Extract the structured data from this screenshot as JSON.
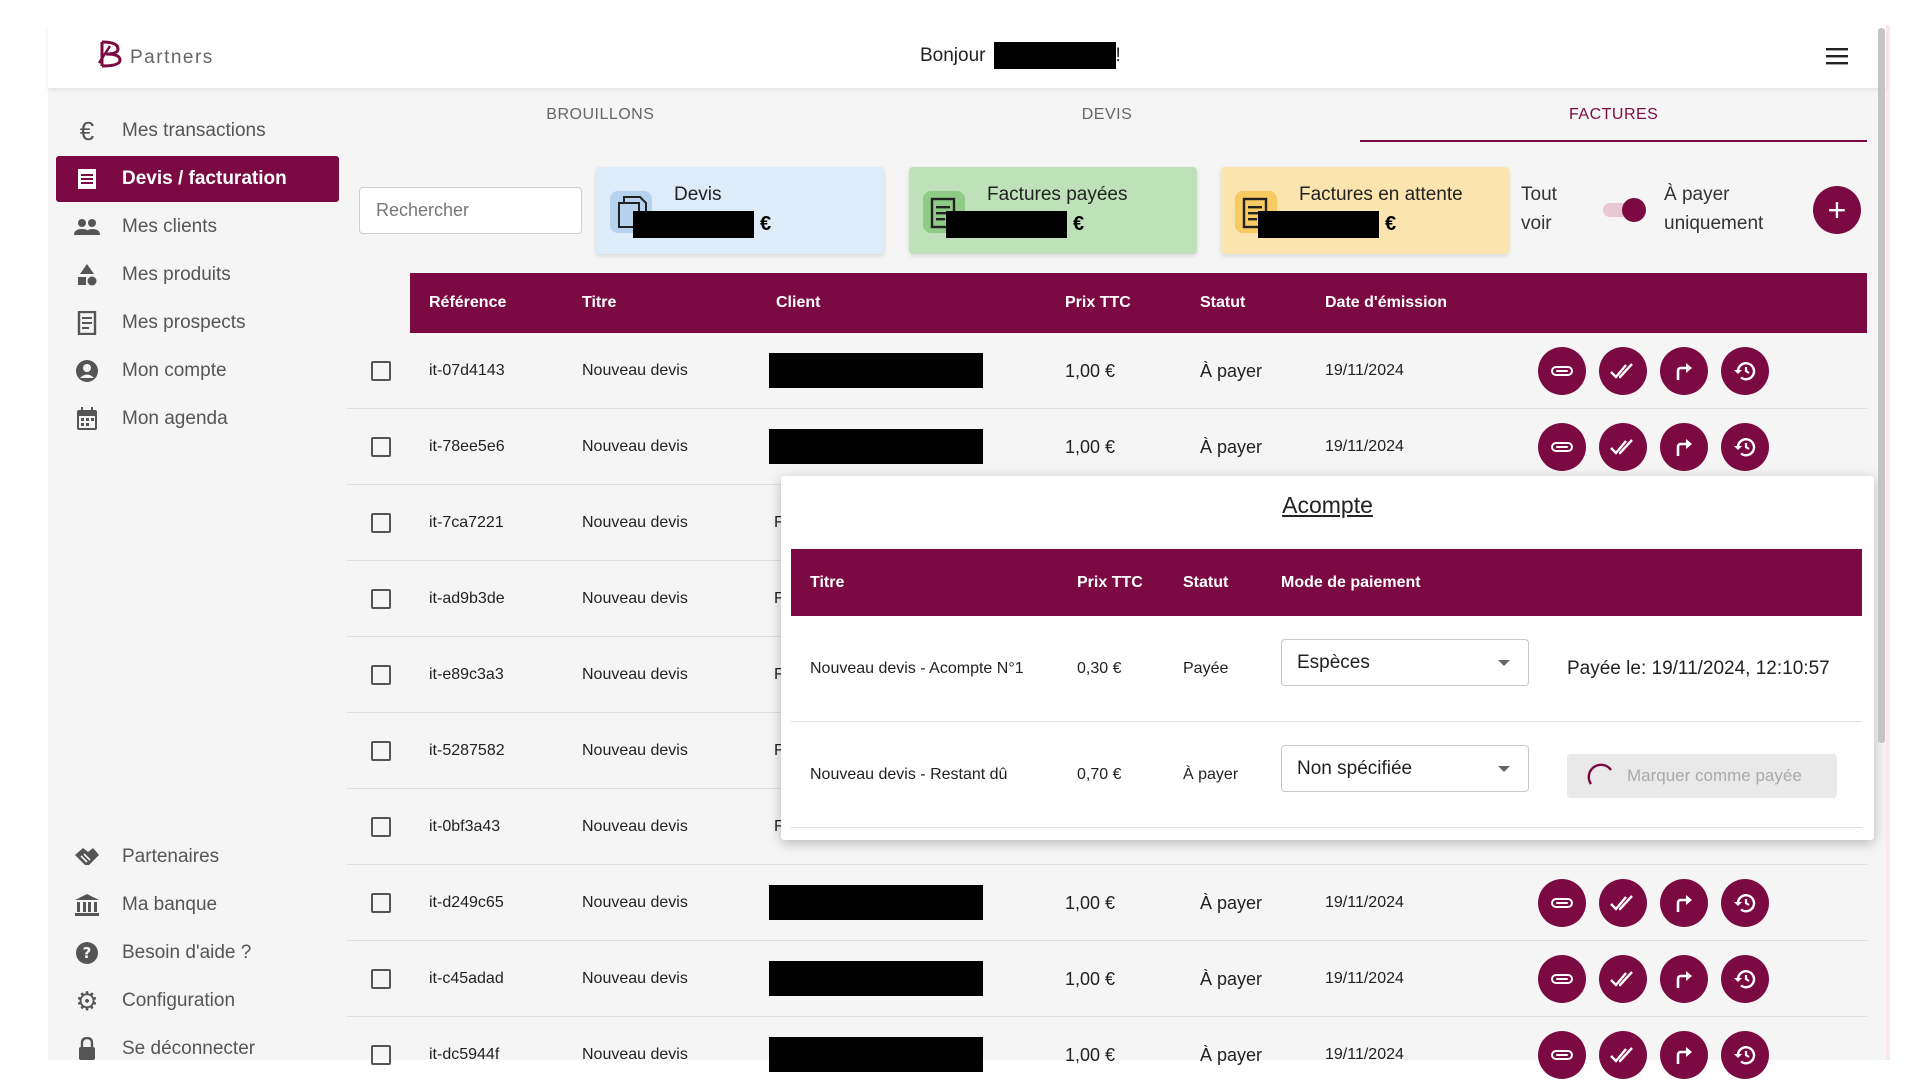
{
  "header": {
    "logo_text": "Partners",
    "greeting_prefix": "Bonjour",
    "greeting_suffix": "!"
  },
  "sidebar": {
    "top_items": [
      {
        "label": "Mes transactions",
        "icon": "euro-icon"
      },
      {
        "label": "Devis / facturation",
        "icon": "invoice-icon",
        "active": true
      },
      {
        "label": "Mes clients",
        "icon": "people-icon"
      },
      {
        "label": "Mes produits",
        "icon": "shapes-icon"
      },
      {
        "label": "Mes prospects",
        "icon": "receipt-icon"
      },
      {
        "label": "Mon compte",
        "icon": "account-circle-icon"
      },
      {
        "label": "Mon agenda",
        "icon": "calendar-icon"
      }
    ],
    "bottom_items": [
      {
        "label": "Partenaires",
        "icon": "handshake-icon"
      },
      {
        "label": "Ma banque",
        "icon": "bank-icon"
      },
      {
        "label": "Besoin d'aide ?",
        "icon": "help-icon"
      },
      {
        "label": "Configuration",
        "icon": "gear-icon"
      },
      {
        "label": "Se déconnecter",
        "icon": "lock-icon"
      }
    ]
  },
  "tabs": [
    {
      "label": "BROUILLONS"
    },
    {
      "label": "DEVIS"
    },
    {
      "label": "FACTURES",
      "active": true
    }
  ],
  "search": {
    "placeholder": "Rechercher"
  },
  "summary_cards": [
    {
      "title": "Devis",
      "currency": "€",
      "bg": "#deebf8",
      "icon_bg": "#b7d2ef"
    },
    {
      "title": "Factures payées",
      "currency": "€",
      "bg": "#bfe1b9",
      "icon_bg": "#8fcb86"
    },
    {
      "title": "Factures en attente",
      "currency": "€",
      "bg": "#fbe4ad",
      "icon_bg": "#f7cb62"
    }
  ],
  "filters": {
    "all_label_line1": "Tout",
    "all_label_line2": "voir",
    "due_label_line1": "À payer",
    "due_label_line2": "uniquement",
    "add_label": "+"
  },
  "table": {
    "headers": {
      "reference": "Référence",
      "title": "Titre",
      "client": "Client",
      "price": "Prix TTC",
      "status": "Statut",
      "date": "Date d'émission"
    },
    "rows": [
      {
        "reference": "it-07d4143",
        "title": "Nouveau devis",
        "price": "1,00 €",
        "status": "À payer",
        "date": "19/11/2024"
      },
      {
        "reference": "it-78ee5e6",
        "title": "Nouveau devis",
        "price": "1,00 €",
        "status": "À payer",
        "date": "19/11/2024"
      },
      {
        "reference": "it-7ca7221",
        "title": "Nouveau devis",
        "client_peek": "F"
      },
      {
        "reference": "it-ad9b3de",
        "title": "Nouveau devis",
        "client_peek": "F"
      },
      {
        "reference": "it-e89c3a3",
        "title": "Nouveau devis",
        "client_peek": "F"
      },
      {
        "reference": "it-5287582",
        "title": "Nouveau devis",
        "client_peek": "F"
      },
      {
        "reference": "it-0bf3a43",
        "title": "Nouveau devis",
        "client_peek": "F"
      },
      {
        "reference": "it-d249c65",
        "title": "Nouveau devis",
        "price": "1,00 €",
        "status": "À payer",
        "date": "19/11/2024"
      },
      {
        "reference": "it-c45adad",
        "title": "Nouveau devis",
        "price": "1,00 €",
        "status": "À payer",
        "date": "19/11/2024"
      },
      {
        "reference": "it-dc5944f",
        "title": "Nouveau devis",
        "price": "1,00 €",
        "status": "À payer",
        "date": "19/11/2024"
      }
    ],
    "action_icons": [
      "paperclip-icon",
      "double-check-icon",
      "forward-arrow-icon",
      "history-icon"
    ]
  },
  "popup": {
    "title": "Acompte",
    "headers": {
      "title": "Titre",
      "price": "Prix TTC",
      "status": "Statut",
      "payment_mode": "Mode de paiement"
    },
    "rows": [
      {
        "title": "Nouveau devis - Acompte N°1",
        "price": "0,30 €",
        "status": "Payée",
        "payment_mode": "Espèces",
        "paid_on": "Payée le: 19/11/2024, 12:10:57"
      },
      {
        "title": "Nouveau devis - Restant dû",
        "price": "0,70 €",
        "status": "À payer",
        "payment_mode": "Non spécifiée",
        "mark_paid_label": "Marquer comme payée"
      }
    ]
  },
  "colors": {
    "brand": "#7c0a42",
    "sidebar_bg": "#f5f5f5"
  }
}
